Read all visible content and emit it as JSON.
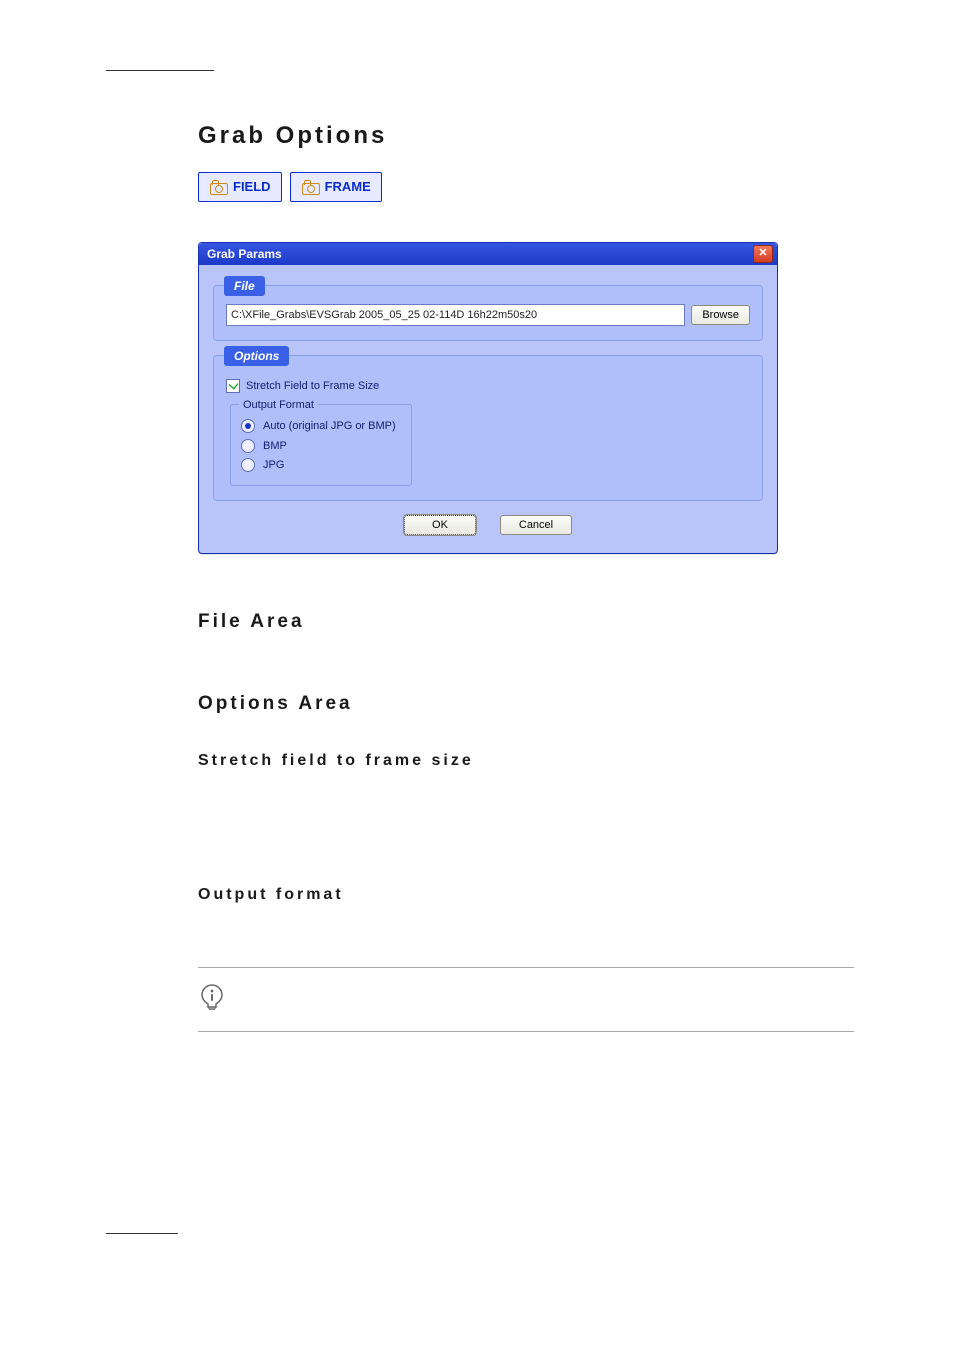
{
  "headings": {
    "grab_options": "Grab  Options",
    "file_area": "File  Area",
    "options_area": "Options  Area",
    "stretch_subhead": "Stretch  field  to  frame  size",
    "output_format_subhead": "Output  format"
  },
  "toolbar": {
    "field_label": "FIELD",
    "frame_label": "FRAME"
  },
  "dialog": {
    "title": "Grab Params",
    "close_glyph": "✕",
    "sections": {
      "file": {
        "label": "File",
        "path_value": "C:\\XFile_Grabs\\EVSGrab 2005_05_25 02-114D 16h22m50s20",
        "browse": "Browse"
      },
      "options": {
        "label": "Options",
        "stretch_checkbox": {
          "label": "Stretch Field to Frame Size",
          "checked": true
        },
        "output_format": {
          "legend": "Output Format",
          "auto": {
            "label": "Auto (original JPG or BMP)",
            "selected": true
          },
          "bmp": {
            "label": "BMP",
            "selected": false
          },
          "jpg": {
            "label": "JPG",
            "selected": false
          }
        }
      }
    },
    "buttons": {
      "ok": "OK",
      "cancel": "Cancel"
    }
  }
}
